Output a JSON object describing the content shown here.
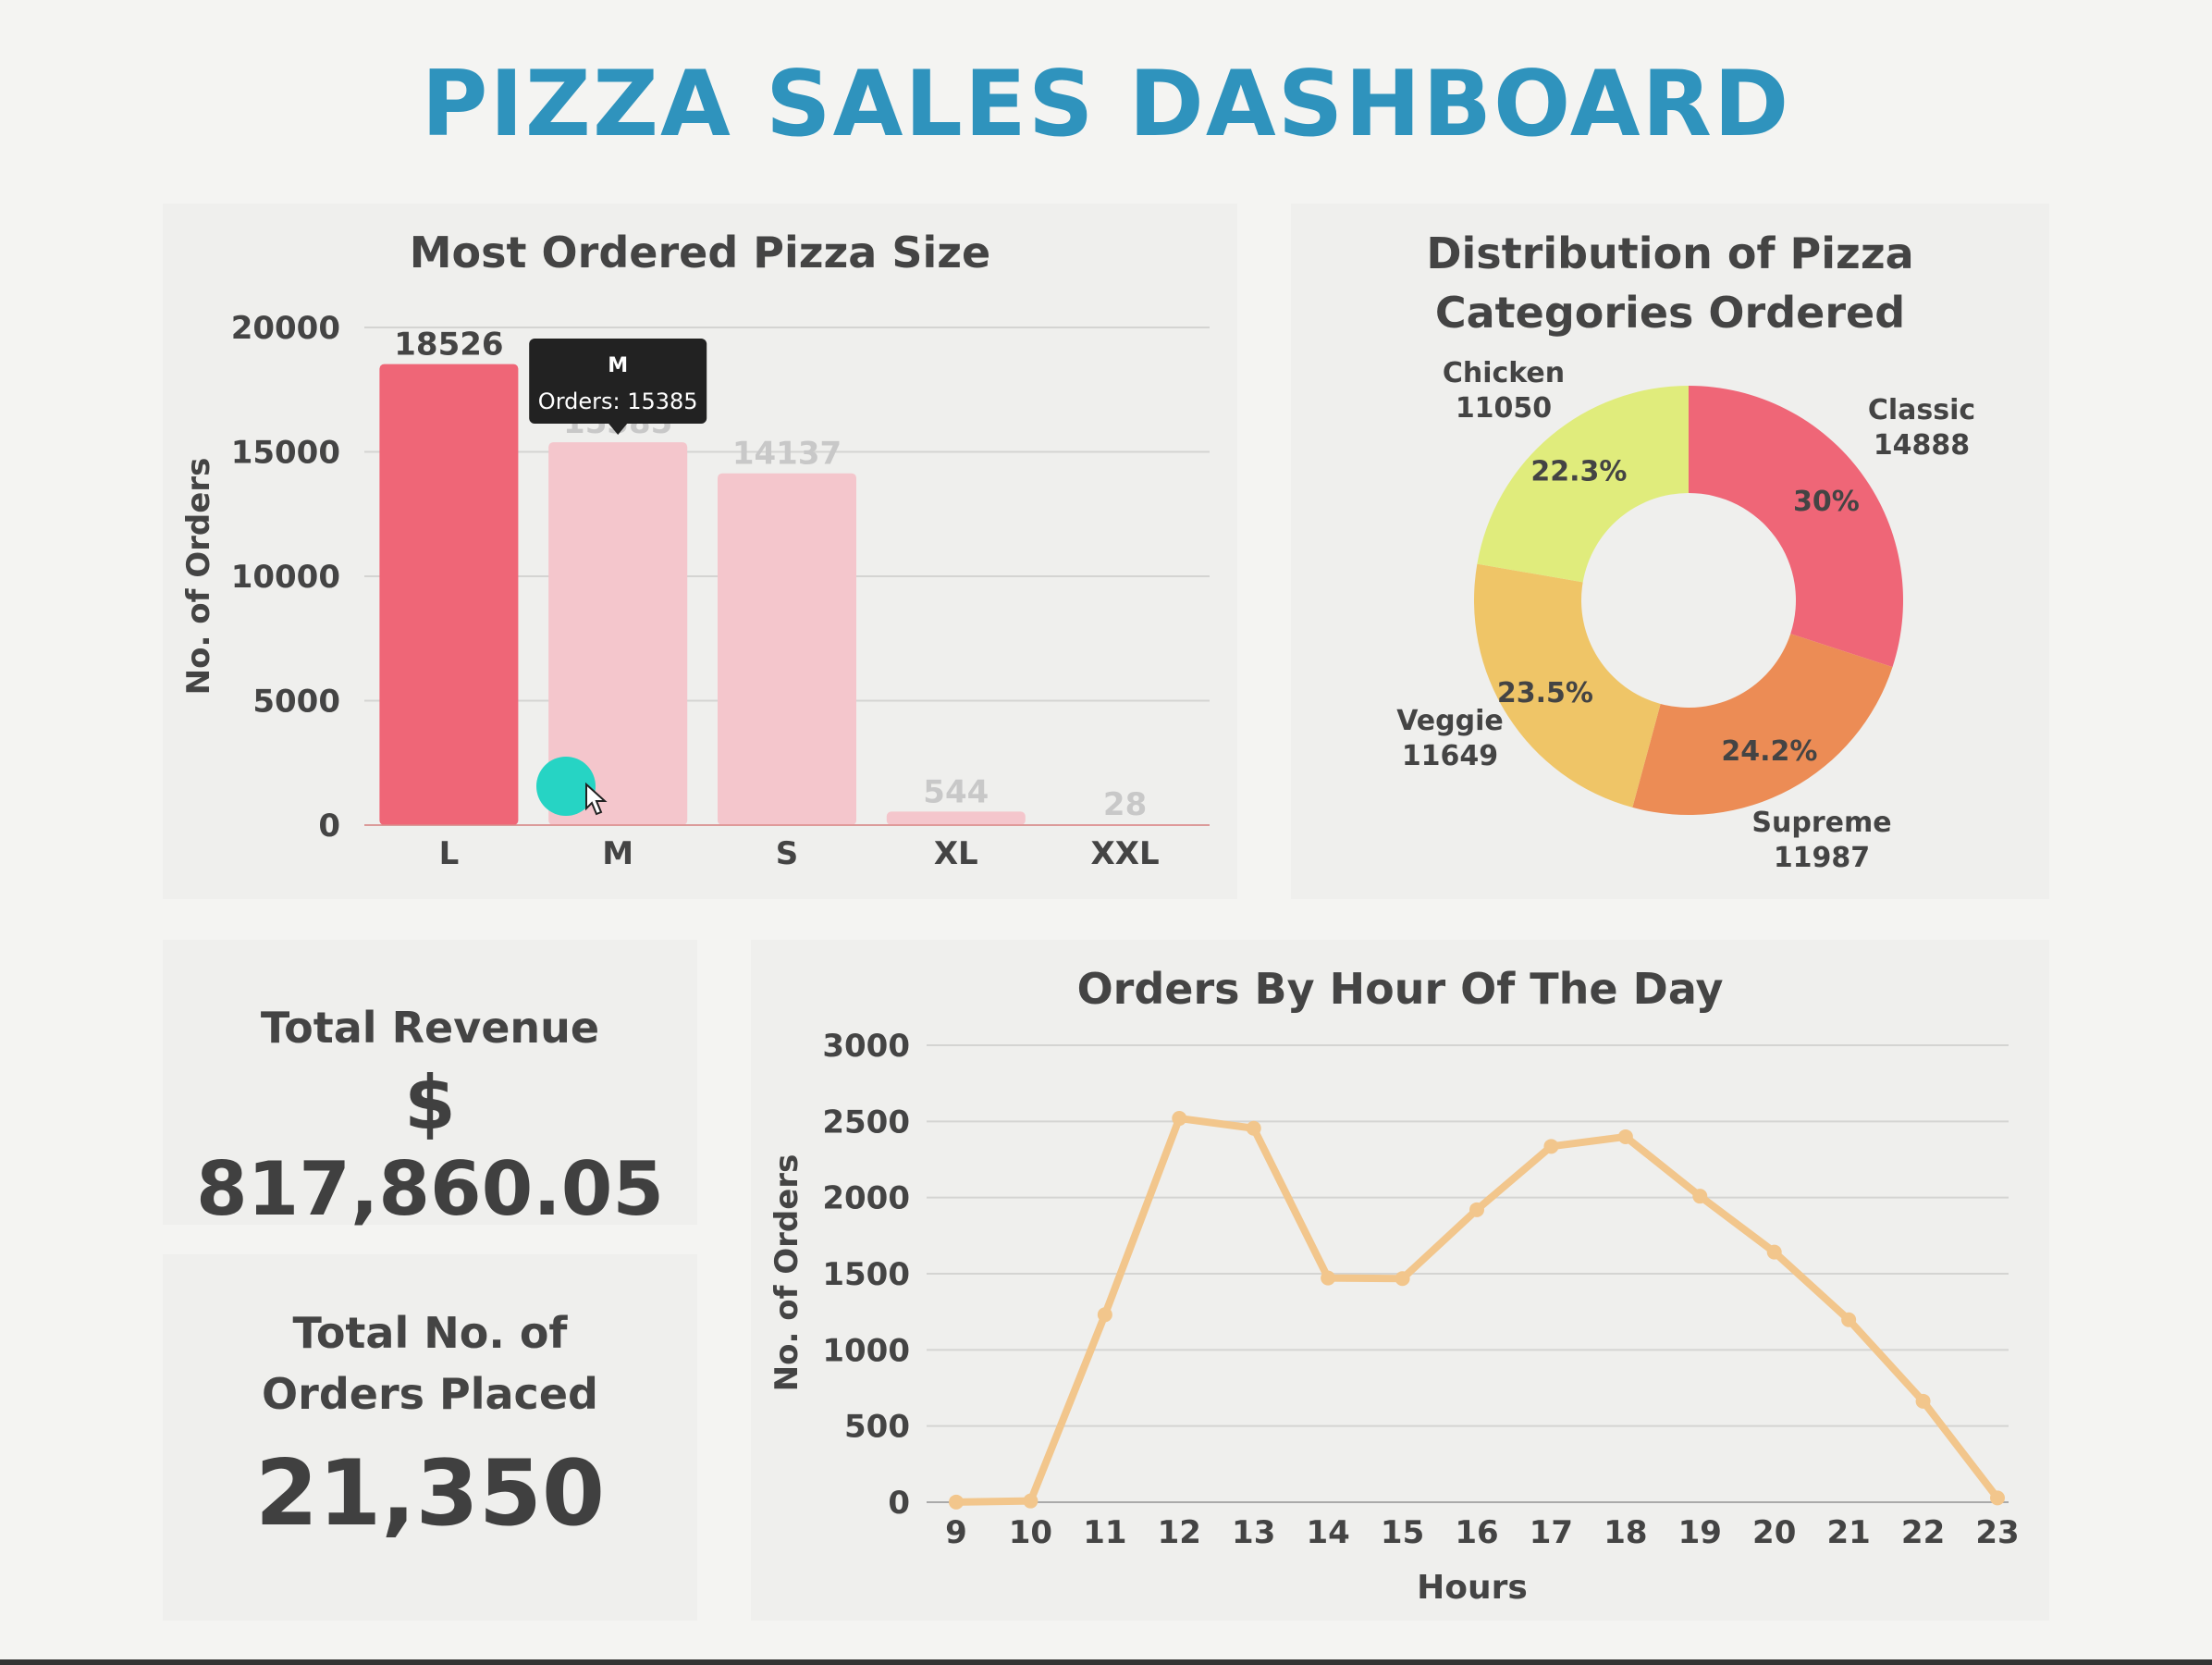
{
  "dashboard": {
    "title": "PIZZA SALES DASHBOARD"
  },
  "colors": {
    "title": "#2f93bd",
    "bar_active": "#ef6677",
    "bar_dim": "#f4c6cc",
    "line": "#f2c68c",
    "pie_classic": "#ef6677",
    "pie_supreme": "#ec8c55",
    "pie_veggie": "#efc567",
    "pie_chicken": "#e0ec7c",
    "cursor_dot": "#26d4c4"
  },
  "chart_data": [
    {
      "type": "bar",
      "title": "Most Ordered Pizza Size",
      "xlabel": "",
      "ylabel": "No. of Orders",
      "categories": [
        "L",
        "M",
        "S",
        "XL",
        "XXL"
      ],
      "values": [
        18526,
        15385,
        14137,
        544,
        28
      ],
      "data_labels": [
        "18526",
        "15385",
        "14137",
        "544",
        "28"
      ],
      "y_ticks": [
        "0",
        "5000",
        "10000",
        "15000",
        "20000"
      ],
      "ylim": [
        0,
        20000
      ],
      "grid": true,
      "tooltip": {
        "category": "M",
        "text": "Orders: 15385"
      }
    },
    {
      "type": "pie",
      "title": "Distribution of Pizza Categories Ordered",
      "slices": [
        {
          "label": "Classic",
          "value": 14888,
          "percent": "30%",
          "color": "#ef6677"
        },
        {
          "label": "Supreme",
          "value": 11987,
          "percent": "24.2%",
          "color": "#ec8c55"
        },
        {
          "label": "Veggie",
          "value": 11649,
          "percent": "23.5%",
          "color": "#efc567"
        },
        {
          "label": "Chicken",
          "value": 11050,
          "percent": "22.3%",
          "color": "#e0ec7c"
        }
      ]
    },
    {
      "type": "line",
      "title": "Orders By Hour Of The Day",
      "xlabel": "Hours",
      "ylabel": "No. of Orders",
      "x": [
        9,
        10,
        11,
        12,
        13,
        14,
        15,
        16,
        17,
        18,
        19,
        20,
        21,
        22,
        23
      ],
      "values": [
        1,
        8,
        1231,
        2520,
        2455,
        1472,
        1468,
        1920,
        2336,
        2399,
        2009,
        1642,
        1198,
        663,
        28
      ],
      "y_ticks": [
        "0",
        "500",
        "1000",
        "1500",
        "2000",
        "2500",
        "3000"
      ],
      "ylim": [
        0,
        3000
      ],
      "grid": true
    }
  ],
  "kpis": {
    "revenue_label": "Total Revenue",
    "revenue_value": "$ 817,860.05",
    "orders_label_line1": "Total No. of",
    "orders_label_line2": "Orders Placed",
    "orders_value": "21,350"
  }
}
